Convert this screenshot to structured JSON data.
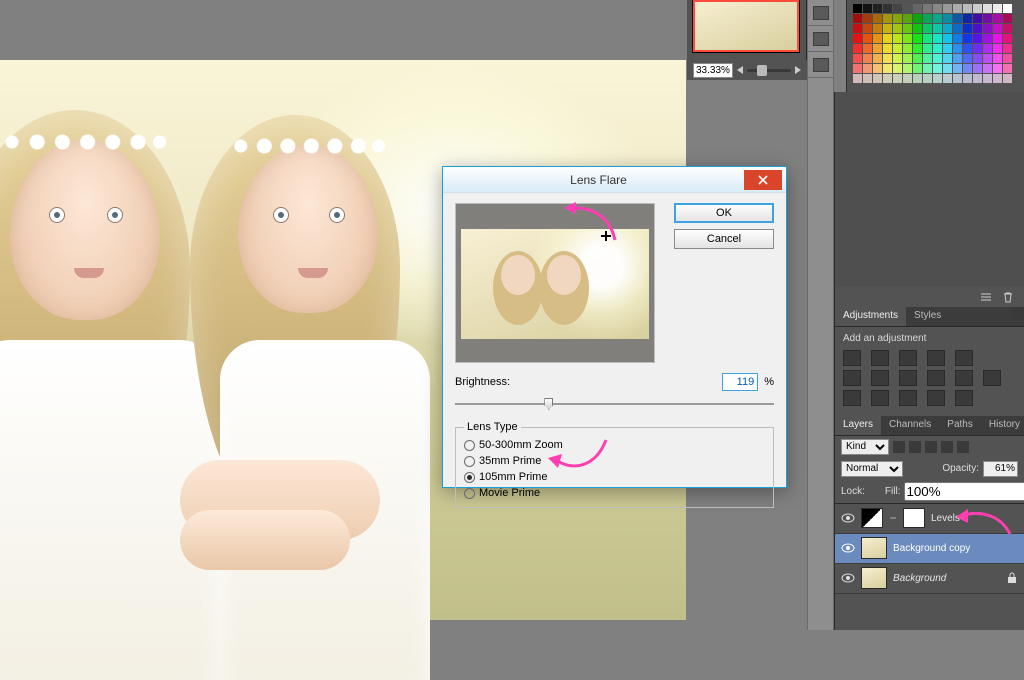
{
  "navigator": {
    "zoom": "33.33%"
  },
  "dialog": {
    "title": "Lens Flare",
    "ok": "OK",
    "cancel": "Cancel",
    "brightness_label": "Brightness:",
    "brightness_value": "119",
    "brightness_unit": "%",
    "lens_type_legend": "Lens Type",
    "lens_options": [
      {
        "label": "50-300mm Zoom",
        "selected": false
      },
      {
        "label": "35mm Prime",
        "selected": false
      },
      {
        "label": "105mm Prime",
        "selected": true
      },
      {
        "label": "Movie Prime",
        "selected": false
      }
    ]
  },
  "adjustments": {
    "tab_adjustments": "Adjustments",
    "tab_styles": "Styles",
    "add_label": "Add an adjustment"
  },
  "layers": {
    "tab_layers": "Layers",
    "tab_channels": "Channels",
    "tab_paths": "Paths",
    "tab_history": "History",
    "kind_label": "Kind",
    "blend": "Normal",
    "opacity_label": "Opacity:",
    "opacity_value": "61%",
    "lock_label": "Lock:",
    "fill_label": "Fill:",
    "fill_value": "100%",
    "items": [
      {
        "name": "Levels 1",
        "selected": false,
        "type": "adjustment",
        "locked": false
      },
      {
        "name": "Background copy",
        "selected": true,
        "type": "pixel",
        "locked": false
      },
      {
        "name": "Background",
        "selected": false,
        "type": "pixel",
        "locked": true
      }
    ]
  }
}
